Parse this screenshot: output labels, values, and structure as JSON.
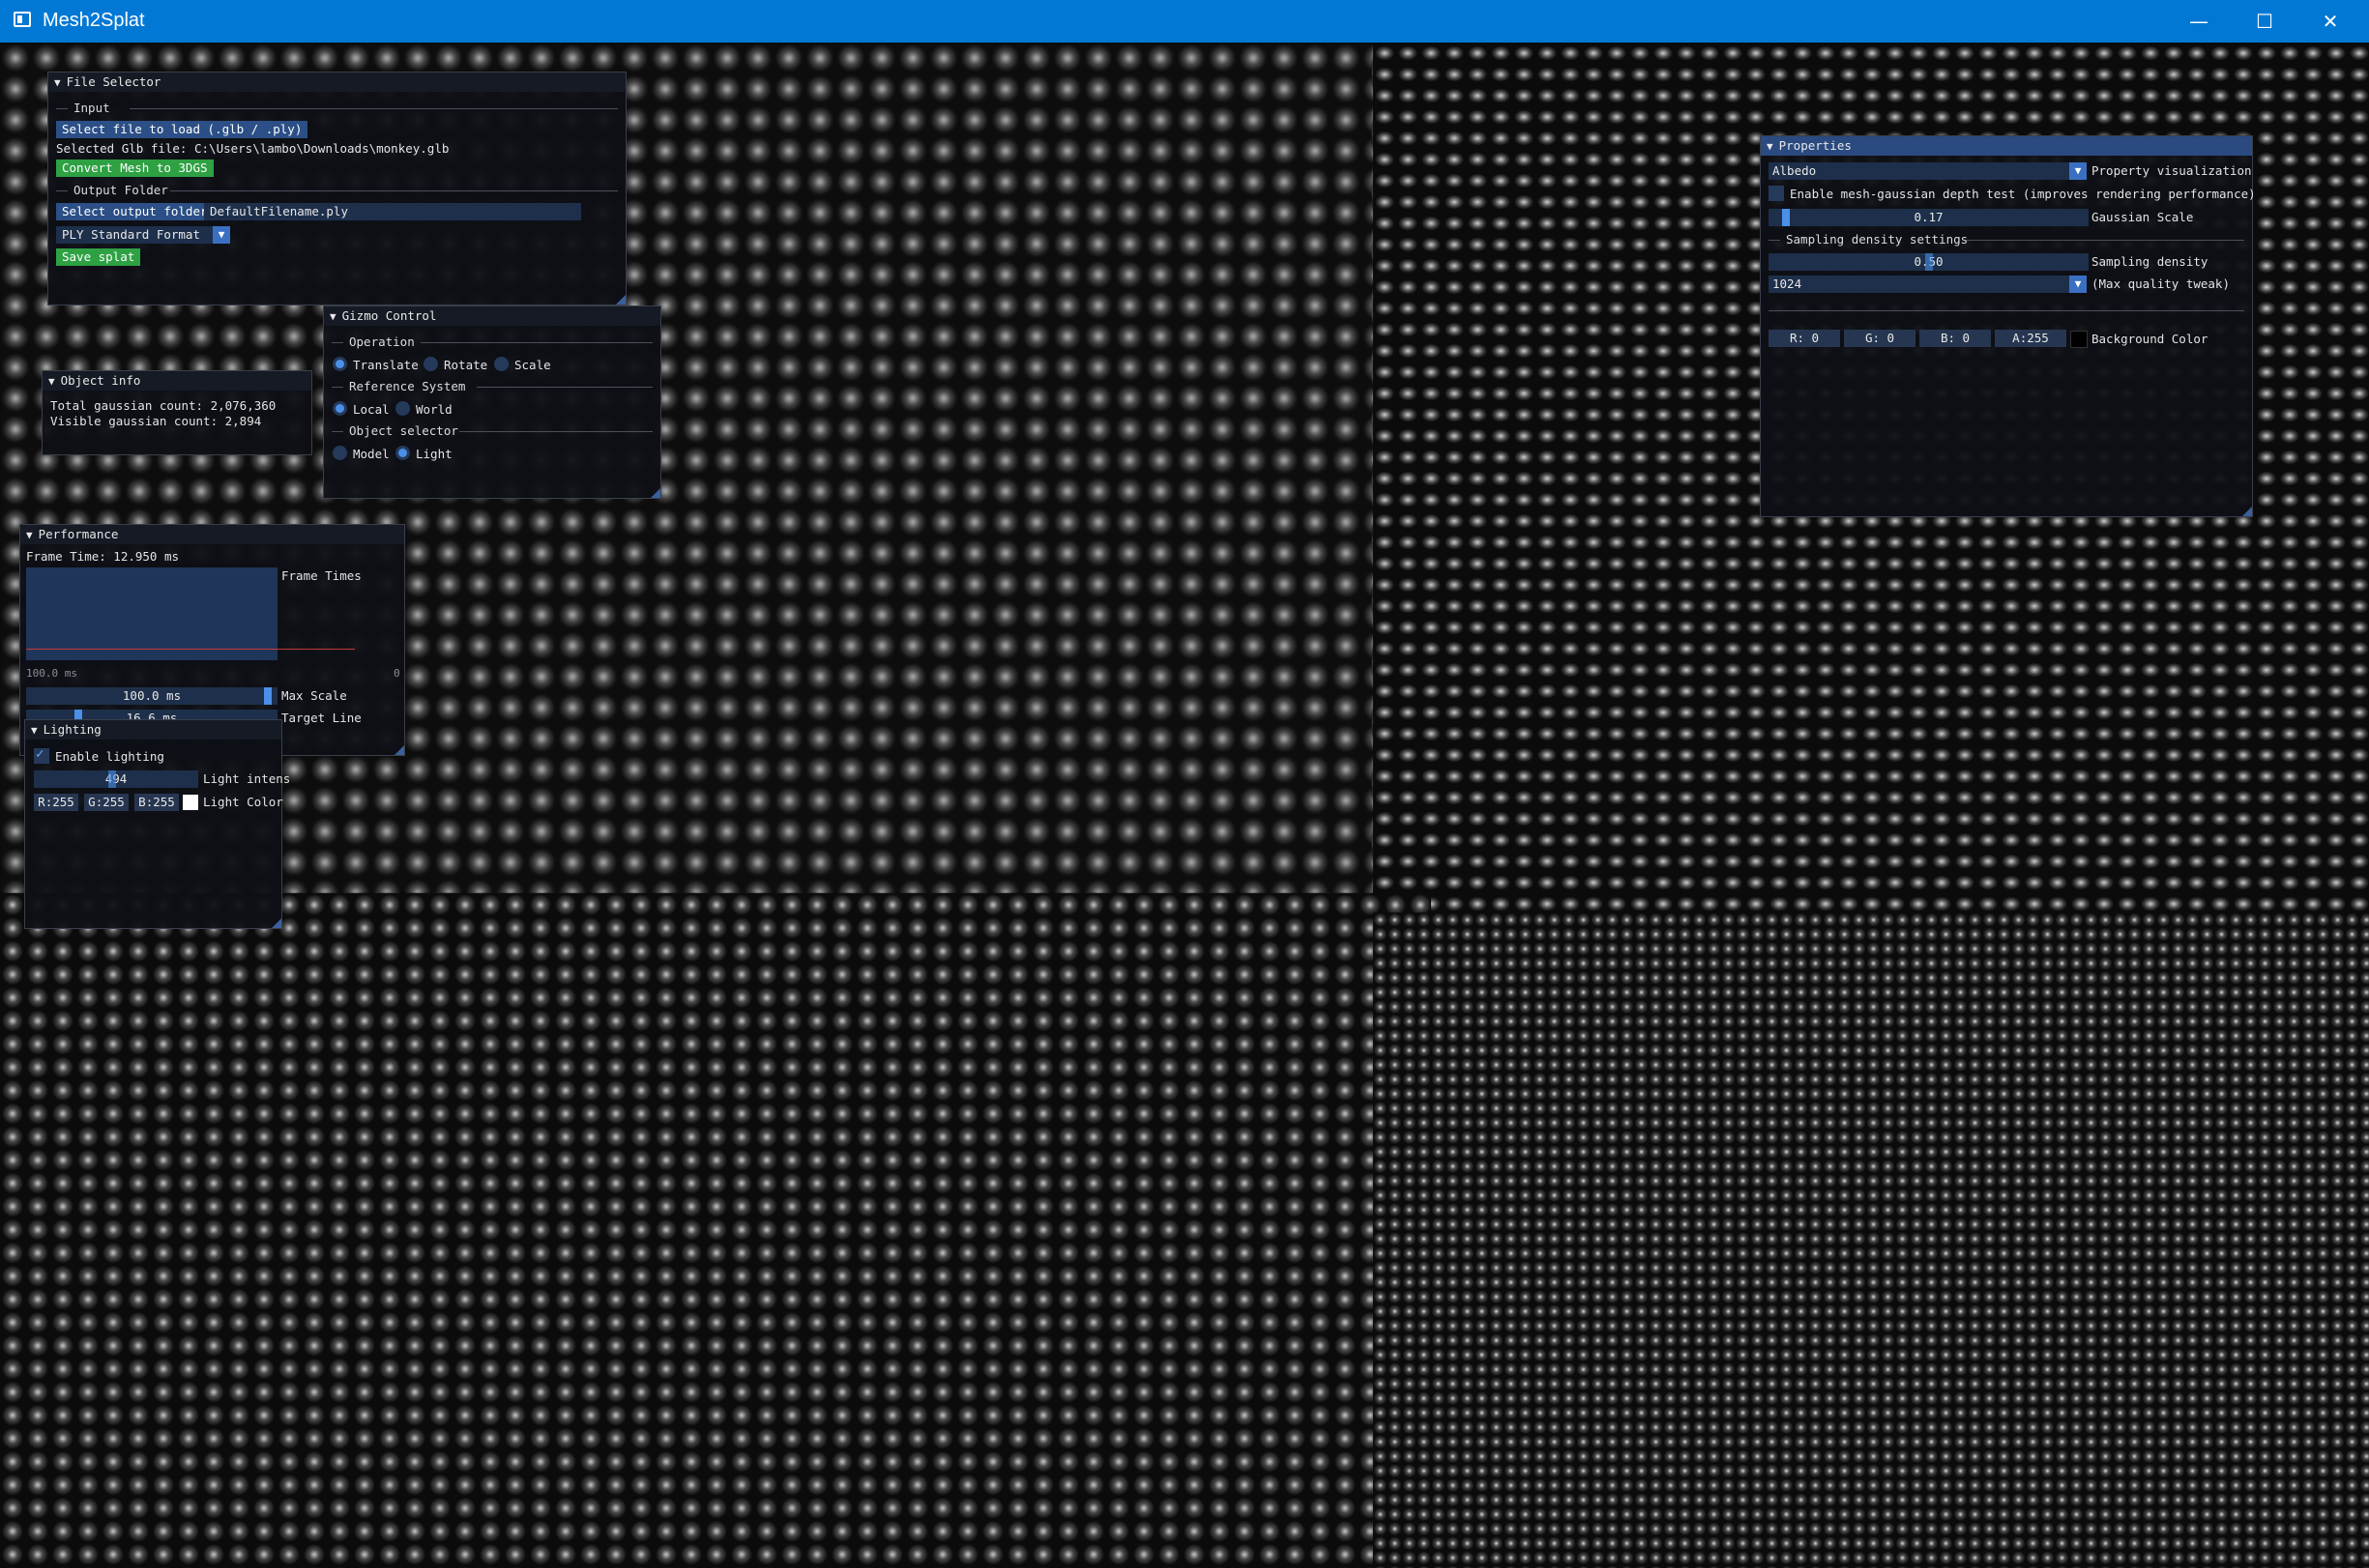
{
  "window": {
    "title": "Mesh2Splat",
    "minimize": "—",
    "maximize": "☐",
    "close": "✕"
  },
  "file_selector": {
    "title": "File Selector",
    "input_section": "Input",
    "select_file_button": "Select file to load (.glb / .ply)",
    "selected_file_text": "Selected Glb file: C:\\Users\\lambo\\Downloads\\monkey.glb",
    "convert_button": "Convert Mesh to 3DGS",
    "output_section": "Output Folder",
    "select_output_button": "Select output folder",
    "filename_value": "DefaultFilename.ply",
    "format_value": "PLY Standard Format",
    "save_button": "Save splat"
  },
  "gizmo_control": {
    "title": "Gizmo Control",
    "operation_section": "Operation",
    "operations": [
      "Translate",
      "Rotate",
      "Scale"
    ],
    "operation_selected": "Translate",
    "reference_section": "Reference System",
    "references": [
      "Local",
      "World"
    ],
    "reference_selected": "Local",
    "object_section": "Object selector",
    "objects": [
      "Model",
      "Light"
    ],
    "object_selected": "Light"
  },
  "object_info": {
    "title": "Object info",
    "total_label": "Total gaussian count: 2,076,360",
    "visible_label": "Visible gaussian count: 2,894"
  },
  "performance": {
    "title": "Performance",
    "frame_time": "Frame Time: 12.950 ms",
    "plot_label": "Frame Times",
    "plot_min_label": "100.0 ms",
    "plot_right_label": "0",
    "max_scale_value": "100.0 ms",
    "max_scale_label": "Max Scale",
    "target_line_value": "16.6 ms",
    "target_line_label": "Target Line"
  },
  "lighting": {
    "title": "Lighting",
    "enable_label": "Enable lighting",
    "enabled": true,
    "intensity_value": "494",
    "intensity_label": "Light intens",
    "r": "R:255",
    "g": "G:255",
    "b": "B:255",
    "color_label": "Light Color",
    "color": "#ffffff"
  },
  "properties": {
    "title": "Properties",
    "visualization_value": "Albedo",
    "visualization_label": "Property visualization",
    "depth_test_label": "Enable mesh-gaussian depth test (improves rendering performance)",
    "depth_test_enabled": false,
    "gaussian_scale_value": "0.17",
    "gaussian_scale_label": "Gaussian Scale",
    "sampling_section": "Sampling density settings",
    "sampling_density_value": "0.50",
    "sampling_density_label": "Sampling density",
    "quality_value": "1024",
    "quality_label": "(Max quality tweak)",
    "bg_r": "R:  0",
    "bg_g": "G:  0",
    "bg_b": "B:  0",
    "bg_a": "A:255",
    "bg_label": "Background Color",
    "bg_color": "#000000"
  }
}
